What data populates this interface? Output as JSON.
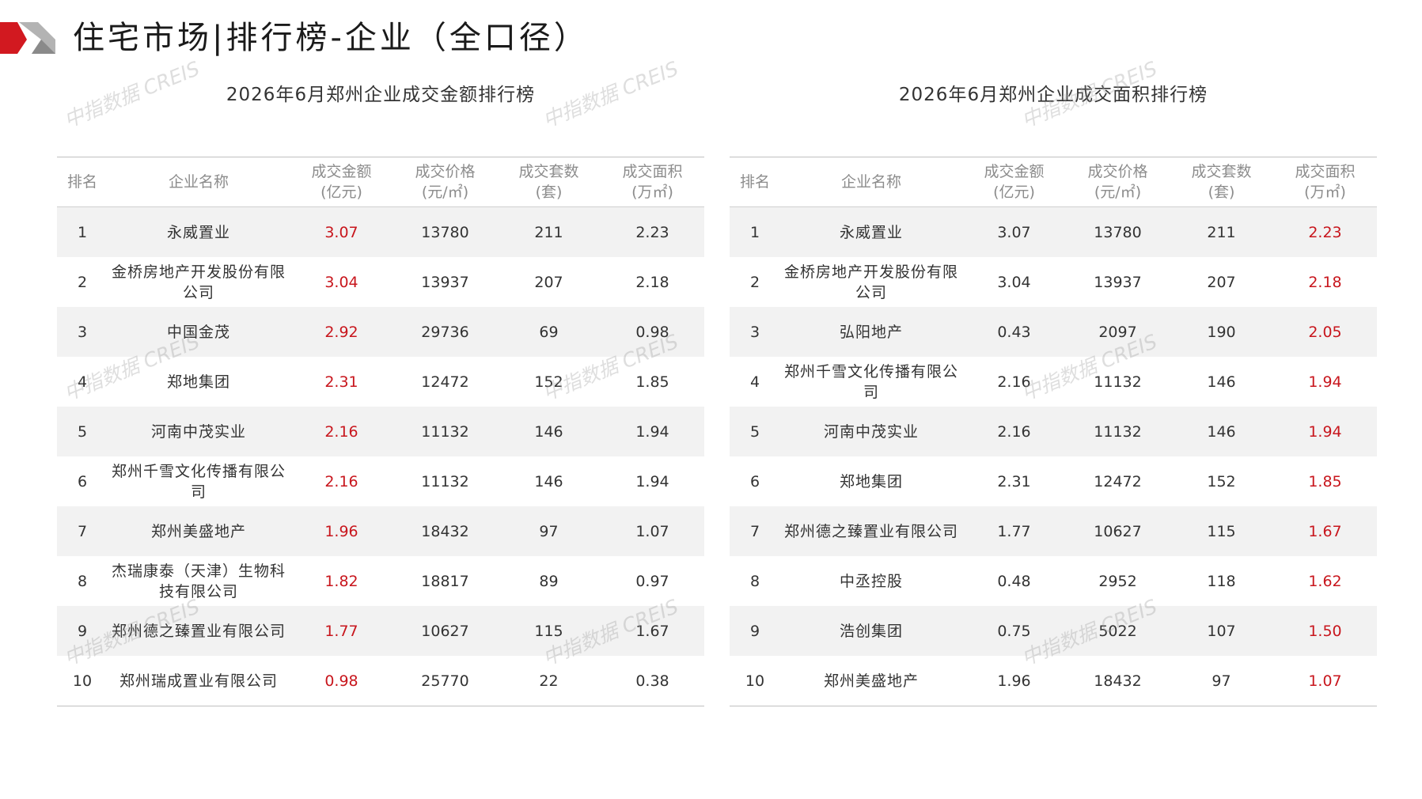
{
  "page_title": "住宅市场|排行榜-企业（全口径）",
  "watermark": "中指数据 CREIS",
  "colors": {
    "accent": "#c8161d",
    "header_text": "#8c8c8c",
    "zebra": "#f2f2f2"
  },
  "headers": {
    "rank": "排名",
    "name": "企业名称",
    "amount": "成交金额",
    "amount_unit": "(亿元)",
    "price": "成交价格",
    "price_unit": "(元/㎡)",
    "units": "成交套数",
    "units_unit": "(套)",
    "area": "成交面积",
    "area_unit": "(万㎡)"
  },
  "tables": [
    {
      "title": "2026年6月郑州企业成交金额排行榜",
      "highlight": "amount",
      "rows": [
        {
          "rank": "1",
          "name": "永威置业",
          "amount": "3.07",
          "price": "13780",
          "units": "211",
          "area": "2.23"
        },
        {
          "rank": "2",
          "name": "金桥房地产开发股份有限公司",
          "amount": "3.04",
          "price": "13937",
          "units": "207",
          "area": "2.18"
        },
        {
          "rank": "3",
          "name": "中国金茂",
          "amount": "2.92",
          "price": "29736",
          "units": "69",
          "area": "0.98"
        },
        {
          "rank": "4",
          "name": "郑地集团",
          "amount": "2.31",
          "price": "12472",
          "units": "152",
          "area": "1.85"
        },
        {
          "rank": "5",
          "name": "河南中茂实业",
          "amount": "2.16",
          "price": "11132",
          "units": "146",
          "area": "1.94"
        },
        {
          "rank": "6",
          "name": "郑州千雪文化传播有限公司",
          "amount": "2.16",
          "price": "11132",
          "units": "146",
          "area": "1.94"
        },
        {
          "rank": "7",
          "name": "郑州美盛地产",
          "amount": "1.96",
          "price": "18432",
          "units": "97",
          "area": "1.07"
        },
        {
          "rank": "8",
          "name": "杰瑞康泰（天津）生物科技有限公司",
          "amount": "1.82",
          "price": "18817",
          "units": "89",
          "area": "0.97"
        },
        {
          "rank": "9",
          "name": "郑州德之臻置业有限公司",
          "amount": "1.77",
          "price": "10627",
          "units": "115",
          "area": "1.67"
        },
        {
          "rank": "10",
          "name": "郑州瑞成置业有限公司",
          "amount": "0.98",
          "price": "25770",
          "units": "22",
          "area": "0.38"
        }
      ]
    },
    {
      "title": "2026年6月郑州企业成交面积排行榜",
      "highlight": "area",
      "rows": [
        {
          "rank": "1",
          "name": "永威置业",
          "amount": "3.07",
          "price": "13780",
          "units": "211",
          "area": "2.23"
        },
        {
          "rank": "2",
          "name": "金桥房地产开发股份有限公司",
          "amount": "3.04",
          "price": "13937",
          "units": "207",
          "area": "2.18"
        },
        {
          "rank": "3",
          "name": "弘阳地产",
          "amount": "0.43",
          "price": "2097",
          "units": "190",
          "area": "2.05"
        },
        {
          "rank": "4",
          "name": "郑州千雪文化传播有限公司",
          "amount": "2.16",
          "price": "11132",
          "units": "146",
          "area": "1.94"
        },
        {
          "rank": "5",
          "name": "河南中茂实业",
          "amount": "2.16",
          "price": "11132",
          "units": "146",
          "area": "1.94"
        },
        {
          "rank": "6",
          "name": "郑地集团",
          "amount": "2.31",
          "price": "12472",
          "units": "152",
          "area": "1.85"
        },
        {
          "rank": "7",
          "name": "郑州德之臻置业有限公司",
          "amount": "1.77",
          "price": "10627",
          "units": "115",
          "area": "1.67"
        },
        {
          "rank": "8",
          "name": "中丞控股",
          "amount": "0.48",
          "price": "2952",
          "units": "118",
          "area": "1.62"
        },
        {
          "rank": "9",
          "name": "浩创集团",
          "amount": "0.75",
          "price": "5022",
          "units": "107",
          "area": "1.50"
        },
        {
          "rank": "10",
          "name": "郑州美盛地产",
          "amount": "1.96",
          "price": "18432",
          "units": "97",
          "area": "1.07"
        }
      ]
    }
  ]
}
